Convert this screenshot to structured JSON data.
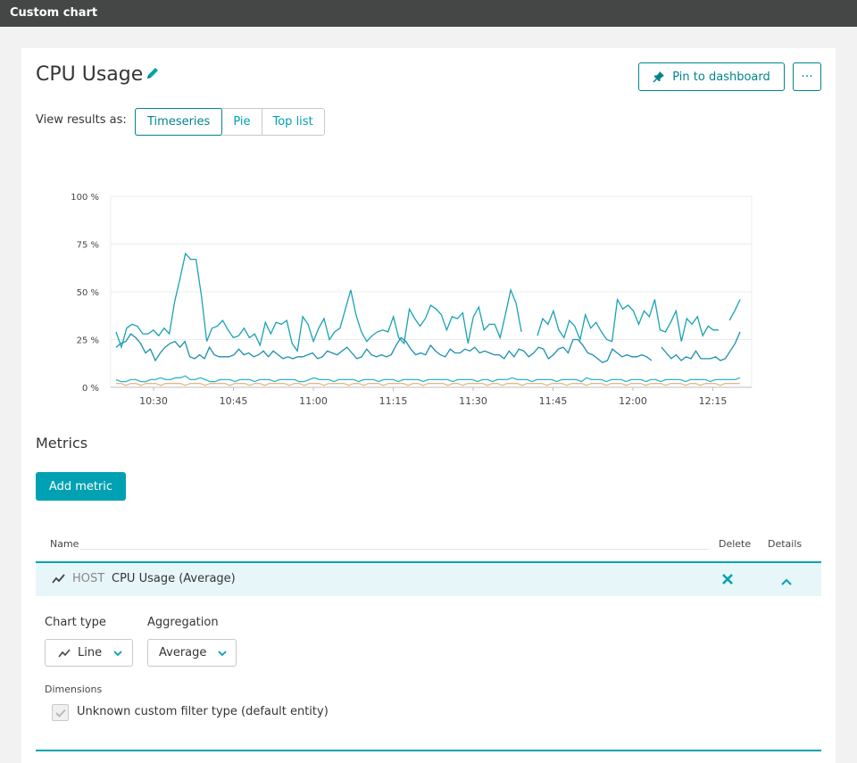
{
  "topbar": {
    "title": "Custom chart"
  },
  "header": {
    "title": "CPU Usage",
    "pin_label": "Pin to dashboard",
    "more_label": "···"
  },
  "view": {
    "label": "View results as:",
    "options": [
      "Timeseries",
      "Pie",
      "Top list"
    ],
    "selected": "Timeseries"
  },
  "chart_data": {
    "type": "line",
    "yticks": [
      "0 %",
      "25 %",
      "50 %",
      "75 %",
      "100 %"
    ],
    "xticks": [
      "10:30",
      "10:45",
      "11:00",
      "11:15",
      "11:30",
      "11:45",
      "12:00",
      "12:15"
    ],
    "ylim": [
      0,
      100
    ],
    "grid": true,
    "colors": [
      "#19a2b4",
      "#1b8fb0",
      "#2ab5c9",
      "#e1b98a"
    ],
    "series": [
      {
        "values": [
          29,
          21,
          31,
          33,
          32,
          28,
          28,
          30,
          27,
          31,
          28,
          45,
          57,
          70,
          67,
          67,
          48,
          24,
          31,
          32,
          35,
          30,
          26,
          27,
          31,
          26,
          28,
          22,
          34,
          28,
          34,
          33,
          35,
          23,
          19,
          37,
          33,
          24,
          31,
          36,
          25,
          29,
          31,
          41,
          51,
          38,
          29,
          24,
          27,
          29,
          30,
          29,
          37,
          26,
          23,
          41,
          36,
          32,
          36,
          43,
          41,
          38,
          30,
          37,
          36,
          39,
          23,
          37,
          42,
          30,
          33,
          33,
          26,
          38,
          51,
          44,
          29,
          null,
          null,
          27,
          36,
          33,
          40,
          30,
          26,
          35,
          32,
          25,
          38,
          31,
          34,
          29,
          25,
          24,
          46,
          41,
          43,
          40,
          33,
          40,
          37,
          46,
          30,
          29,
          34,
          40,
          24,
          36,
          33,
          37,
          27,
          32,
          30,
          30,
          null,
          35,
          40,
          46
        ]
      },
      {
        "values": [
          21,
          23,
          24,
          28,
          26,
          23,
          18,
          20,
          14,
          18,
          21,
          23,
          24,
          21,
          24,
          16,
          15,
          17,
          15,
          21,
          17,
          16,
          16,
          16,
          17,
          20,
          17,
          18,
          16,
          17,
          19,
          16,
          19,
          17,
          15,
          16,
          15,
          16,
          16,
          17,
          18,
          15,
          16,
          19,
          18,
          17,
          19,
          21,
          18,
          15,
          16,
          20,
          17,
          16,
          17,
          16,
          17,
          22,
          26,
          24,
          20,
          17,
          18,
          17,
          22,
          19,
          17,
          16,
          20,
          18,
          18,
          20,
          19,
          21,
          18,
          19,
          18,
          17,
          17,
          15,
          19,
          16,
          20,
          19,
          16,
          18,
          21,
          20,
          15,
          17,
          20,
          21,
          18,
          25,
          25,
          22,
          18,
          17,
          15,
          13,
          14,
          20,
          18,
          16,
          17,
          16,
          16,
          17,
          16,
          14,
          null,
          21,
          18,
          15,
          17,
          14,
          16,
          15,
          19,
          15,
          15,
          15,
          16,
          14,
          15,
          19,
          23,
          29
        ]
      },
      {
        "values": [
          4,
          3,
          3,
          4,
          4,
          3,
          3,
          4,
          4,
          5,
          4,
          4,
          5,
          5,
          6,
          4,
          4,
          5,
          4,
          3,
          3,
          4,
          4,
          4,
          3,
          4,
          4,
          4,
          3,
          4,
          4,
          4,
          3,
          4,
          4,
          4,
          4,
          3,
          3,
          4,
          5,
          4,
          4,
          4,
          3,
          4,
          4,
          4,
          4,
          3,
          4,
          4,
          4,
          3,
          4,
          4,
          4,
          3,
          4,
          4,
          4,
          4,
          3,
          4,
          4,
          4,
          4,
          4,
          3,
          4,
          4,
          4,
          4,
          3,
          4,
          4,
          3,
          4,
          4,
          4,
          5,
          4,
          4,
          4,
          3,
          4,
          4,
          4,
          4,
          3,
          4,
          4,
          4,
          4,
          3,
          5,
          4,
          4,
          4,
          3,
          4,
          4,
          4,
          3,
          4,
          4,
          4,
          3,
          4,
          4,
          3,
          4,
          4,
          4,
          4,
          3,
          4,
          4,
          4,
          4,
          3,
          4,
          4,
          4,
          4,
          4,
          5
        ]
      },
      {
        "values": [
          2,
          2,
          1,
          2,
          2,
          1,
          2,
          2,
          2,
          1,
          2,
          2,
          2,
          2,
          1,
          2,
          2,
          2,
          1,
          2,
          2,
          2,
          2,
          1,
          2,
          2,
          2,
          1,
          2,
          2,
          1,
          2,
          2,
          2,
          2,
          1,
          2,
          2,
          1,
          2,
          2,
          2,
          1,
          2,
          2,
          2,
          2,
          1,
          2,
          2,
          1,
          2,
          2,
          2,
          1,
          2,
          2,
          2,
          2,
          1,
          2,
          2,
          1,
          2,
          2,
          2,
          2,
          1,
          2,
          2,
          1,
          2,
          2,
          2,
          2,
          1,
          2,
          2,
          1,
          2,
          2,
          2,
          1,
          2,
          2,
          2,
          2,
          1,
          2,
          2,
          2,
          1,
          2,
          2,
          2,
          1,
          2,
          2,
          2,
          1,
          2,
          2,
          2,
          1,
          2,
          2,
          2,
          1,
          2,
          2,
          2,
          1,
          2,
          2,
          2,
          1,
          2,
          2,
          1,
          2,
          2,
          2,
          1,
          2,
          2,
          2,
          2
        ]
      }
    ]
  },
  "metrics": {
    "heading": "Metrics",
    "add_label": "Add metric",
    "columns": {
      "name": "Name",
      "delete": "Delete",
      "details": "Details"
    },
    "row": {
      "entity": "HOST",
      "name": "CPU Usage (Average)"
    },
    "chart_type": {
      "label": "Chart type",
      "value": "Line"
    },
    "aggregation": {
      "label": "Aggregation",
      "value": "Average"
    },
    "dimensions": {
      "label": "Dimensions",
      "checkbox_label": "Unknown custom filter type (default entity)",
      "checked": true
    }
  }
}
